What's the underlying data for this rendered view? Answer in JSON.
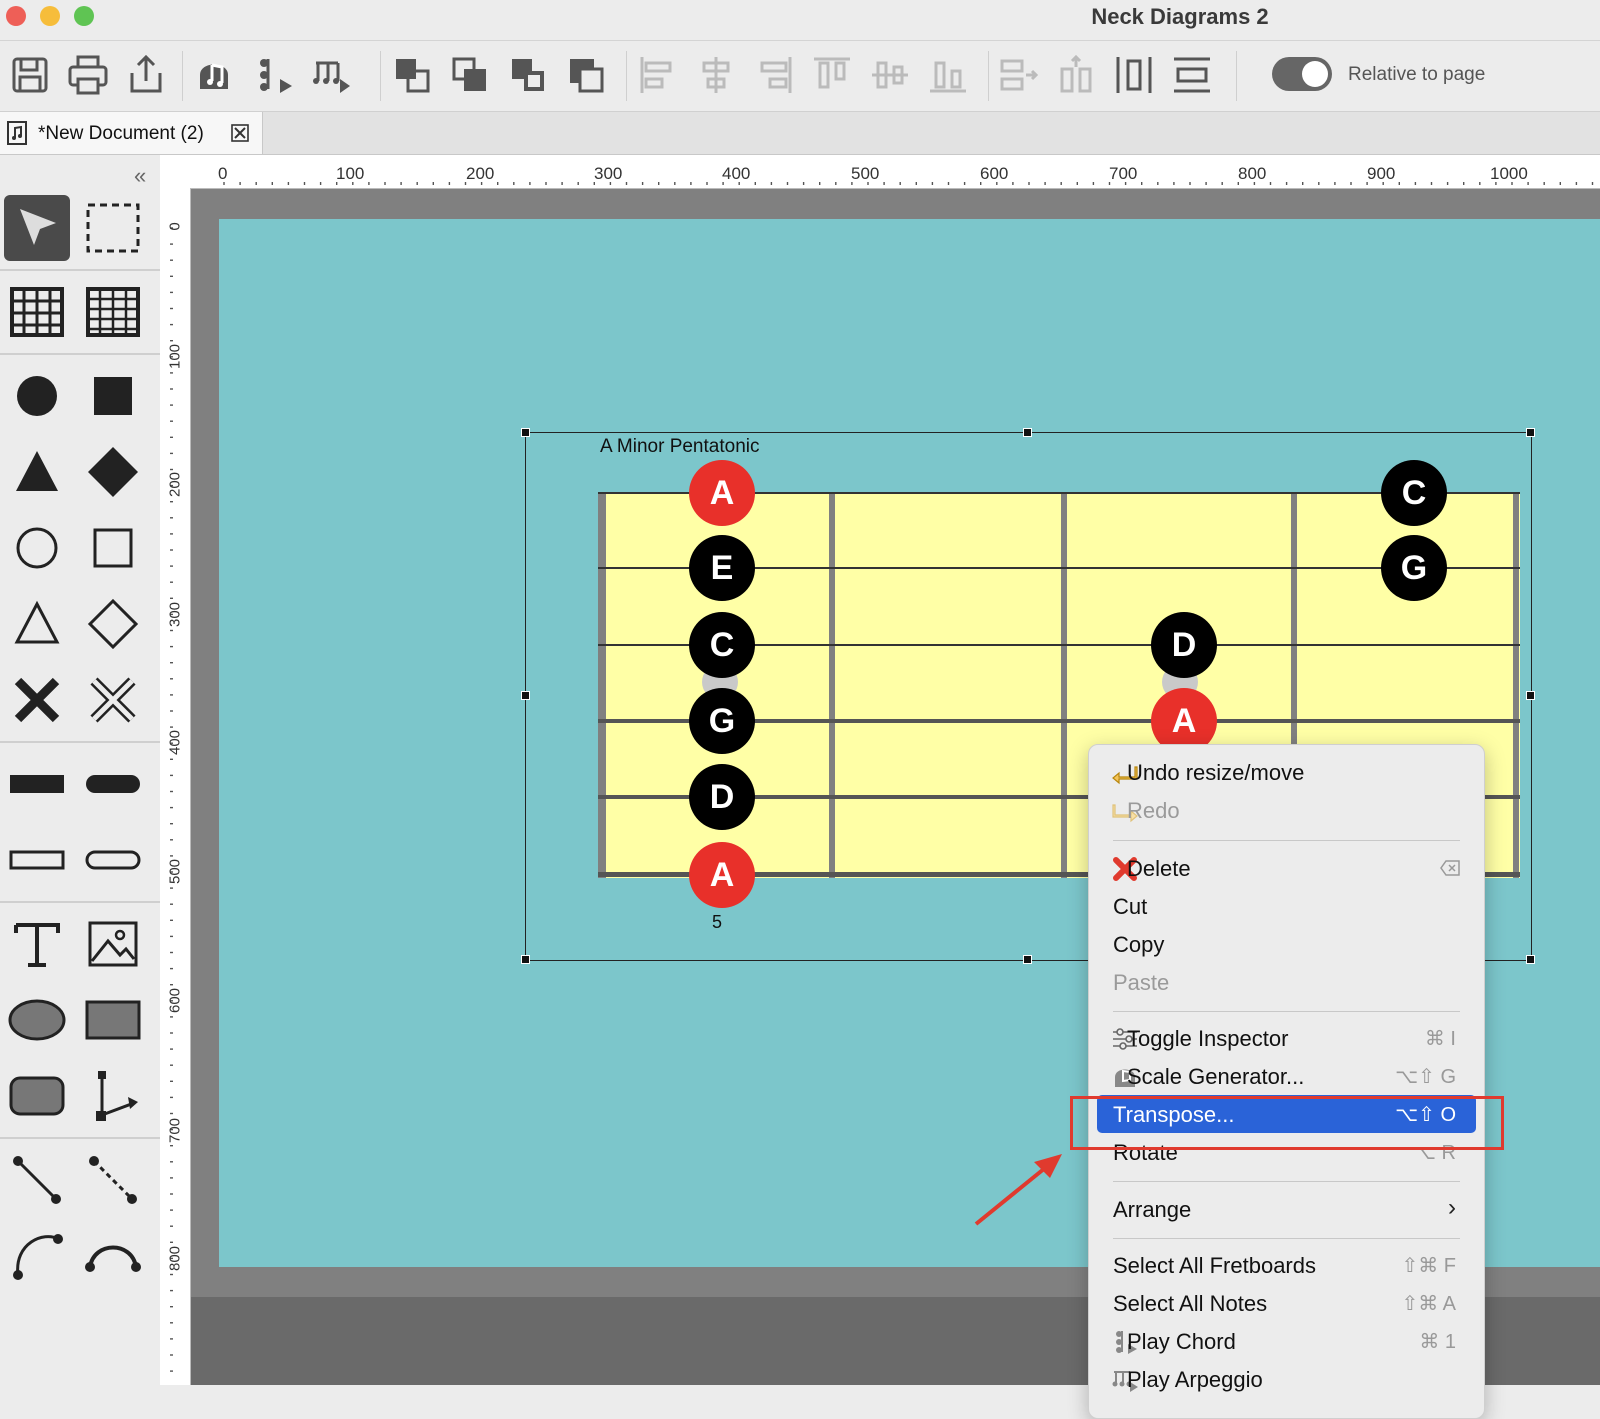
{
  "window": {
    "title": "Neck Diagrams 2"
  },
  "toolbar": {
    "relative_to_page_label": "Relative to page",
    "relative_to_page_on": true
  },
  "tab": {
    "label": "*New Document (2)"
  },
  "ruler": {
    "horizontal": [
      "0",
      "100",
      "200",
      "300",
      "400",
      "500",
      "600",
      "700",
      "800",
      "900",
      "1000"
    ],
    "vertical": [
      "0",
      "100",
      "200",
      "300",
      "400",
      "500",
      "600",
      "700",
      "800"
    ]
  },
  "diagram": {
    "title": "A Minor Pentatonic",
    "fret_number": "5",
    "notes": [
      {
        "label": "A",
        "string": 1,
        "fret": 1,
        "color": "red"
      },
      {
        "label": "E",
        "string": 2,
        "fret": 1,
        "color": "black"
      },
      {
        "label": "C",
        "string": 3,
        "fret": 1,
        "color": "black"
      },
      {
        "label": "G",
        "string": 4,
        "fret": 1,
        "color": "black"
      },
      {
        "label": "D",
        "string": 5,
        "fret": 1,
        "color": "black"
      },
      {
        "label": "A",
        "string": 6,
        "fret": 1,
        "color": "red"
      },
      {
        "label": "D",
        "string": 3,
        "fret": 3,
        "color": "black"
      },
      {
        "label": "A",
        "string": 4,
        "fret": 3,
        "color": "red"
      },
      {
        "label": "C",
        "string": 1,
        "fret": 4,
        "color": "black"
      },
      {
        "label": "G",
        "string": 2,
        "fret": 4,
        "color": "black"
      }
    ]
  },
  "context_menu": {
    "undo": "Undo resize/move",
    "redo": "Redo",
    "delete": "Delete",
    "cut": "Cut",
    "copy": "Copy",
    "paste": "Paste",
    "toggle_inspector": "Toggle Inspector",
    "toggle_inspector_sc": "⌘ I",
    "scale_generator": "Scale Generator...",
    "scale_generator_sc": "⌥⇧ G",
    "transpose": "Transpose...",
    "transpose_sc": "⌥⇧ O",
    "rotate": "Rotate",
    "rotate_sc": "⌥ R",
    "arrange": "Arrange",
    "select_all_fretboards": "Select All Fretboards",
    "select_all_fretboards_sc": "⇧⌘ F",
    "select_all_notes": "Select All Notes",
    "select_all_notes_sc": "⇧⌘ A",
    "play_chord": "Play Chord",
    "play_chord_sc": "⌘ 1",
    "play_arpeggio": "Play Arpeggio"
  },
  "colors": {
    "page_bg": "#7cc6cb",
    "fretboard": "#ffffa6",
    "note_red": "#e8302a",
    "note_black": "#000000",
    "menu_highlight": "#2a63d8",
    "annotation": "#e03a2e"
  }
}
